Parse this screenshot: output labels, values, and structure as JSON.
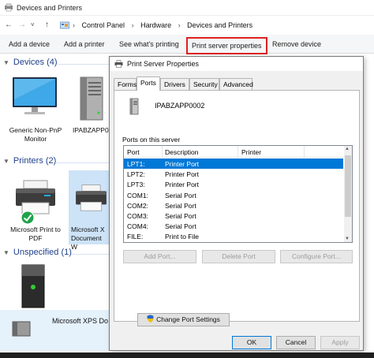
{
  "window": {
    "title": "Devices and Printers"
  },
  "address": {
    "back": "←",
    "forward": "→",
    "down": "˅",
    "up": "↑",
    "crumbs": [
      "Control Panel",
      "Hardware",
      "Devices and Printers"
    ],
    "separator": "›"
  },
  "commands": {
    "add_device": "Add a device",
    "add_printer": "Add a printer",
    "see_printing": "See what's printing",
    "print_server_properties": "Print server properties",
    "remove_device": "Remove device"
  },
  "sections": {
    "devices": "Devices (4)",
    "printers": "Printers (2)",
    "unspecified": "Unspecified (1)"
  },
  "devices": [
    {
      "label": "Generic Non-PnP Monitor",
      "icon": "monitor-icon"
    },
    {
      "label": "IPABZAPP0",
      "icon": "server-tower-icon"
    }
  ],
  "printers": [
    {
      "label": "Microsoft Print to PDF",
      "icon": "printer-icon",
      "default": true
    },
    {
      "label": "Microsoft X Document W",
      "icon": "printer-icon",
      "selected": true
    }
  ],
  "unspecified": [
    {
      "label": "Microsoft XPS Do",
      "icon": "server-tower-icon"
    }
  ],
  "dialog": {
    "title": "Print Server Properties",
    "tabs": [
      "Forms",
      "Ports",
      "Drivers",
      "Security",
      "Advanced"
    ],
    "active_tab": "Ports",
    "server_name": "IPABZAPP0002",
    "ports_label": "Ports on this server",
    "columns": [
      "Port",
      "Description",
      "Printer"
    ],
    "ports": [
      {
        "port": "LPT1:",
        "description": "Printer Port",
        "printer": "",
        "selected": true
      },
      {
        "port": "LPT2:",
        "description": "Printer Port",
        "printer": ""
      },
      {
        "port": "LPT3:",
        "description": "Printer Port",
        "printer": ""
      },
      {
        "port": "COM1:",
        "description": "Serial Port",
        "printer": ""
      },
      {
        "port": "COM2:",
        "description": "Serial Port",
        "printer": ""
      },
      {
        "port": "COM3:",
        "description": "Serial Port",
        "printer": ""
      },
      {
        "port": "COM4:",
        "description": "Serial Port",
        "printer": ""
      },
      {
        "port": "FILE:",
        "description": "Print to File",
        "printer": ""
      }
    ],
    "buttons": {
      "add_port": "Add Port...",
      "delete_port": "Delete Port",
      "configure_port": "Configure Port...",
      "change_port_settings": "Change Port Settings",
      "ok": "OK",
      "cancel": "Cancel",
      "apply": "Apply"
    }
  },
  "colors": {
    "selection": "#0078d7",
    "section_heading": "#1e3e8a",
    "highlight_border": "#dd2222",
    "command_bar": "#f5f6f7"
  }
}
